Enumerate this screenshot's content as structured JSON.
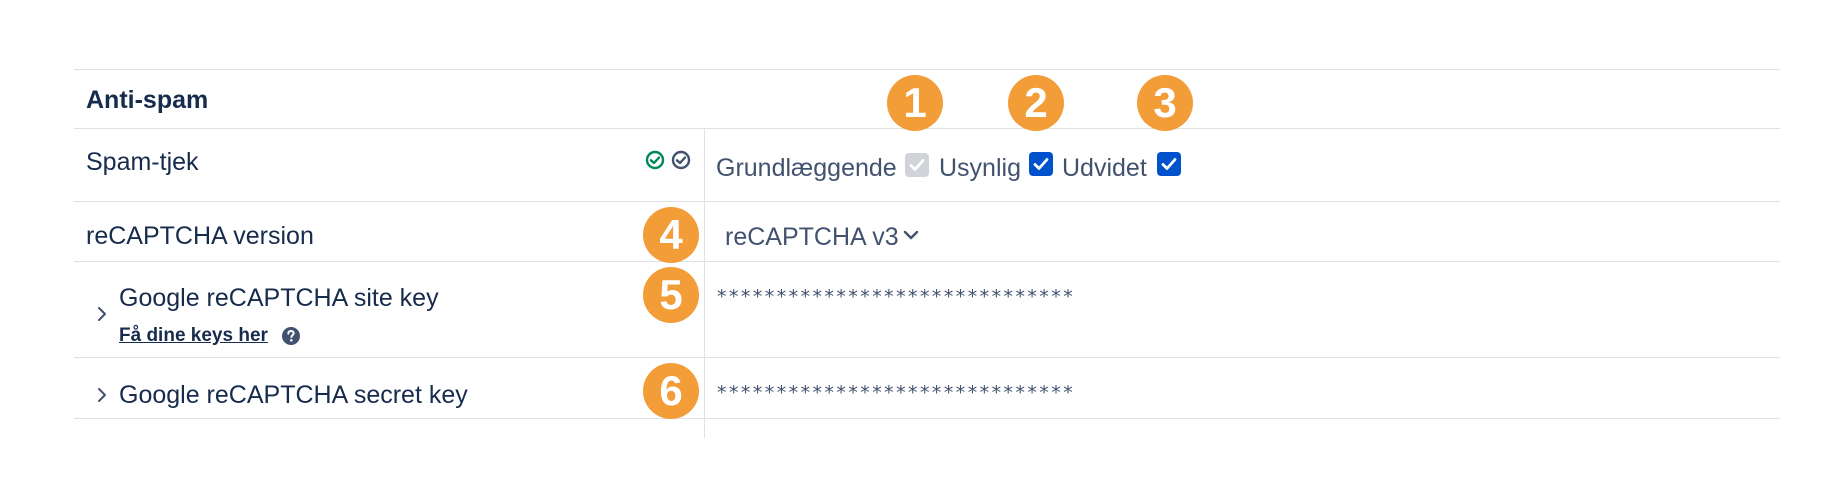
{
  "section": {
    "title": "Anti-spam"
  },
  "rows": {
    "spam_check": {
      "label": "Spam-tjek",
      "options": [
        {
          "label": "Grundlæggende",
          "checked": true,
          "disabled": true
        },
        {
          "label": "Usynlig",
          "checked": true,
          "disabled": false
        },
        {
          "label": "Udvidet",
          "checked": true,
          "disabled": false
        }
      ]
    },
    "recaptcha_version": {
      "label": "reCAPTCHA version",
      "value": "reCAPTCHA v3"
    },
    "site_key": {
      "label": "Google reCAPTCHA site key",
      "link": "Få dine keys her",
      "value": "******************************"
    },
    "secret_key": {
      "label": "Google reCAPTCHA secret key",
      "value": "******************************"
    }
  },
  "badges": [
    "1",
    "2",
    "3",
    "4",
    "5",
    "6"
  ],
  "icons": {
    "status_green": "check-circle-icon",
    "status_gray": "check-circle-icon",
    "help": "question-circle-icon",
    "expand": "chevron-right-icon",
    "dropdown": "chevron-down-icon"
  },
  "colors": {
    "badge": "#f29d38",
    "checkbox": "#0052cc",
    "checkbox_disabled": "#d0d3d8",
    "status_green": "#00875a",
    "text": "#172b4d"
  }
}
